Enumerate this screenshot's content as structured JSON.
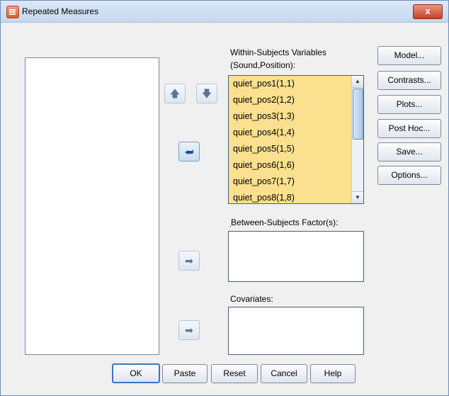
{
  "window": {
    "title": "Repeated Measures",
    "close_label": "x"
  },
  "within": {
    "label_line1": "Within-Subjects Variables",
    "label_line2": "(Sound,Position):",
    "items": [
      "quiet_pos1(1,1)",
      "quiet_pos2(1,2)",
      "quiet_pos3(1,3)",
      "quiet_pos4(1,4)",
      "quiet_pos5(1,5)",
      "quiet_pos6(1,6)",
      "quiet_pos7(1,7)",
      "quiet_pos8(1,8)"
    ]
  },
  "between": {
    "label": "Between-Subjects Factor(s):"
  },
  "covariates": {
    "label": "Covariates:"
  },
  "side_buttons": {
    "model": "Model...",
    "contrasts": "Contrasts...",
    "plots": "Plots...",
    "posthoc": "Post Hoc...",
    "save": "Save...",
    "options": "Options..."
  },
  "bottom_buttons": {
    "ok": "OK",
    "paste": "Paste",
    "reset": "Reset",
    "cancel": "Cancel",
    "help": "Help"
  },
  "icons": {
    "up": "arrow-up-icon",
    "down": "arrow-down-icon",
    "move_within": "move-left-icon",
    "move_between": "move-right-icon",
    "move_covariates": "move-right-icon"
  }
}
